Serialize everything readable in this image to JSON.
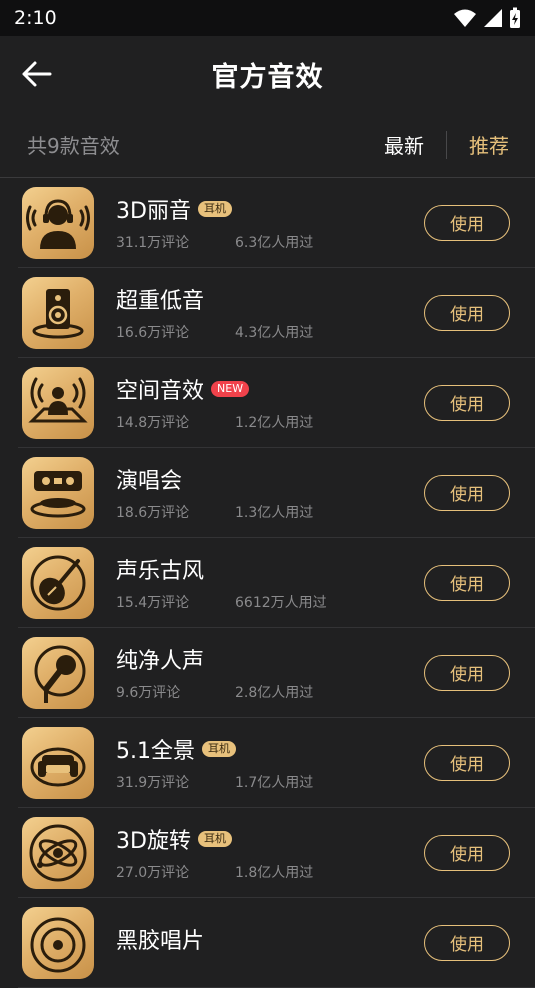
{
  "status": {
    "time": "2:10"
  },
  "header": {
    "title": "官方音效"
  },
  "subbar": {
    "count": "共9款音效",
    "sort_latest": "最新",
    "sort_recommend": "推荐"
  },
  "items": [
    {
      "name": "3D丽音",
      "tag": "耳机",
      "tag_type": "earphone",
      "reviews": "31.1万评论",
      "users": "6.3亿人用过",
      "button": "使用",
      "icon": "headphone-person-icon"
    },
    {
      "name": "超重低音",
      "tag": "",
      "tag_type": "",
      "reviews": "16.6万评论",
      "users": "4.3亿人用过",
      "button": "使用",
      "icon": "speaker-icon"
    },
    {
      "name": "空间音效",
      "tag": "NEW",
      "tag_type": "new",
      "reviews": "14.8万评论",
      "users": "1.2亿人用过",
      "button": "使用",
      "icon": "spatial-person-icon"
    },
    {
      "name": "演唱会",
      "tag": "",
      "tag_type": "",
      "reviews": "18.6万评论",
      "users": "1.3亿人用过",
      "button": "使用",
      "icon": "concert-stage-icon"
    },
    {
      "name": "声乐古风",
      "tag": "",
      "tag_type": "",
      "reviews": "15.4万评论",
      "users": "6612万人用过",
      "button": "使用",
      "icon": "pipa-icon"
    },
    {
      "name": "纯净人声",
      "tag": "",
      "tag_type": "",
      "reviews": "9.6万评论",
      "users": "2.8亿人用过",
      "button": "使用",
      "icon": "microphone-icon"
    },
    {
      "name": "5.1全景",
      "tag": "耳机",
      "tag_type": "earphone",
      "reviews": "31.9万评论",
      "users": "1.7亿人用过",
      "button": "使用",
      "icon": "sofa-surround-icon"
    },
    {
      "name": "3D旋转",
      "tag": "耳机",
      "tag_type": "earphone",
      "reviews": "27.0万评论",
      "users": "1.8亿人用过",
      "button": "使用",
      "icon": "orbit-icon"
    },
    {
      "name": "黑胶唱片",
      "tag": "",
      "tag_type": "",
      "reviews": "",
      "users": "",
      "button": "使用",
      "icon": "vinyl-record-icon"
    }
  ],
  "colors": {
    "accent": "#e6c07b",
    "background": "#202021",
    "new_badge": "#f0424b"
  }
}
